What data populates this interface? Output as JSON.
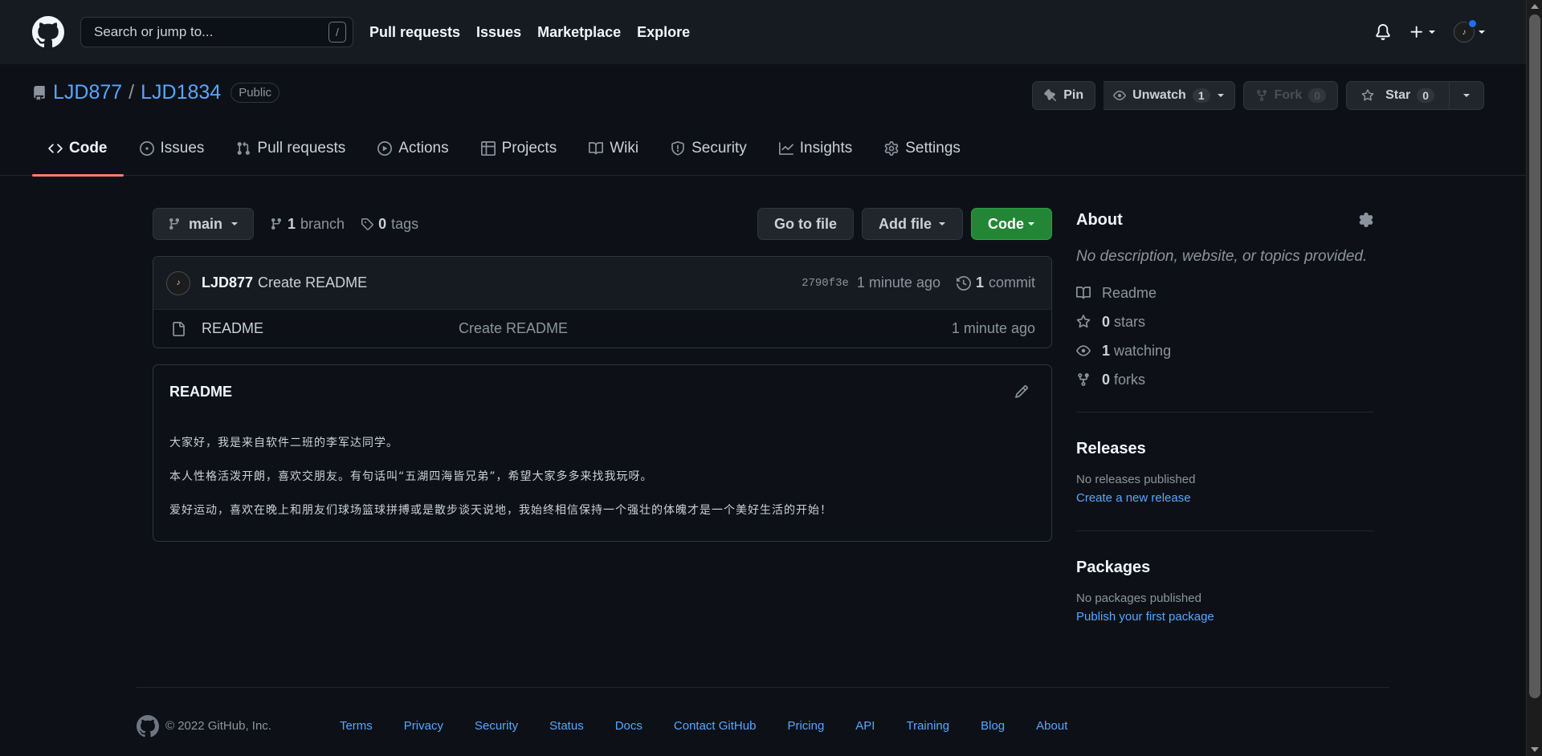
{
  "header": {
    "search_placeholder": "Search or jump to...",
    "search_shortcut": "/",
    "nav": [
      "Pull requests",
      "Issues",
      "Marketplace",
      "Explore"
    ]
  },
  "repo": {
    "owner": "LJD877",
    "separator": "/",
    "name": "LJD1834",
    "visibility": "Public",
    "actions": {
      "pin": "Pin",
      "unwatch": "Unwatch",
      "watch_count": "1",
      "fork": "Fork",
      "fork_count": "0",
      "star": "Star",
      "star_count": "0"
    },
    "tabs": [
      "Code",
      "Issues",
      "Pull requests",
      "Actions",
      "Projects",
      "Wiki",
      "Security",
      "Insights",
      "Settings"
    ]
  },
  "filebar": {
    "branch": "main",
    "branch_count": "1",
    "branch_label": "branch",
    "tag_count": "0",
    "tag_label": "tags",
    "go_to_file": "Go to file",
    "add_file": "Add file",
    "code": "Code"
  },
  "commit": {
    "author": "LJD877",
    "message": "Create README",
    "sha": "2790f3e",
    "age": "1 minute ago",
    "count": "1",
    "count_label": "commit"
  },
  "files": [
    {
      "name": "README",
      "message": "Create README",
      "age": "1 minute ago"
    }
  ],
  "readme": {
    "title": "README",
    "lines": [
      "大家好，我是来自软件二班的李军达同学。",
      "本人性格活泼开朗，喜欢交朋友。有句话叫“五湖四海皆兄弟”，希望大家多多来找我玩呀。",
      "爱好运动，喜欢在晚上和朋友们球场篮球拼搏或是散步谈天说地，我始终相信保持一个强壮的体魄才是一个美好生活的开始！"
    ]
  },
  "sidebar": {
    "about_title": "About",
    "about_desc": "No description, website, or topics provided.",
    "readme_label": "Readme",
    "stars_count": "0",
    "stars_label": "stars",
    "watching_count": "1",
    "watching_label": "watching",
    "forks_count": "0",
    "forks_label": "forks",
    "releases_title": "Releases",
    "releases_empty": "No releases published",
    "releases_link": "Create a new release",
    "packages_title": "Packages",
    "packages_empty": "No packages published",
    "packages_link": "Publish your first package"
  },
  "footer": {
    "copyright": "© 2022 GitHub, Inc.",
    "links": [
      "Terms",
      "Privacy",
      "Security",
      "Status",
      "Docs",
      "Contact GitHub",
      "Pricing",
      "API",
      "Training",
      "Blog",
      "About"
    ]
  },
  "colors": {
    "bg": "#0d1117",
    "header_bg": "#161b22",
    "link": "#58a6ff",
    "green": "#238636",
    "active_tab": "#f78166"
  }
}
